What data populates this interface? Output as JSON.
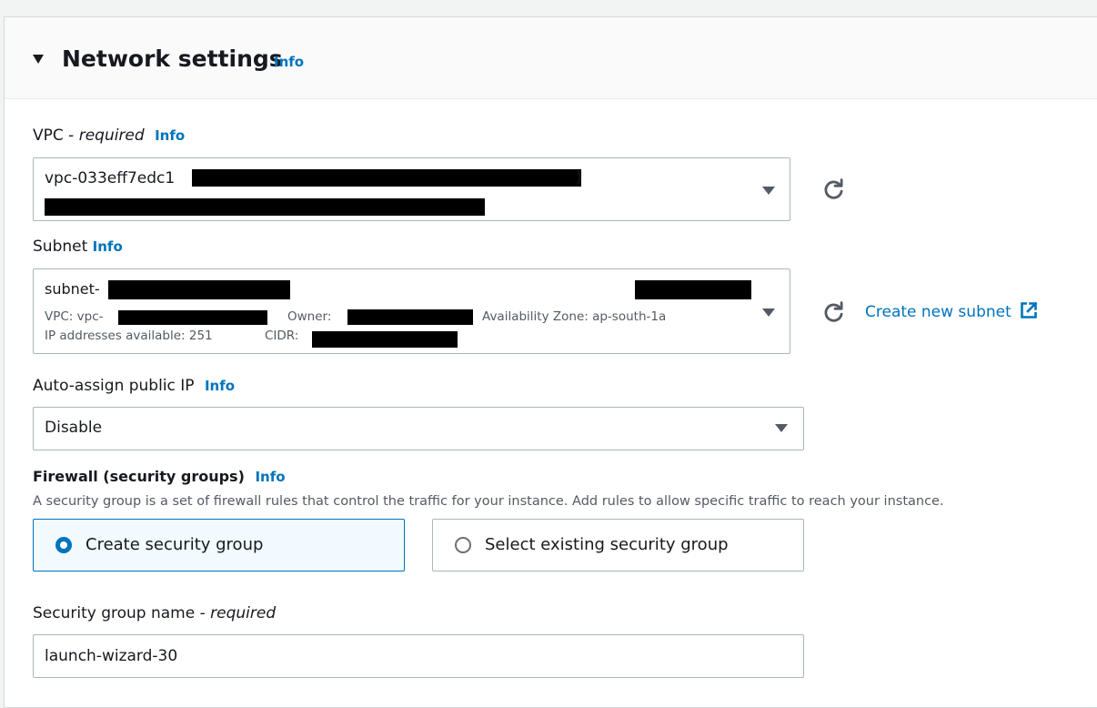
{
  "header": {
    "title": "Network settings",
    "info": "Info"
  },
  "vpc": {
    "label": "VPC - ",
    "required": "required",
    "info": "Info",
    "value": "vpc-033eff7edc1",
    "paren_close": ")"
  },
  "subnet": {
    "label": "Subnet",
    "info": "Info",
    "value": "subnet-",
    "meta_vpc": "VPC: vpc-",
    "meta_owner": "Owner: ",
    "meta_az": "Availability Zone: ap-south-1a",
    "meta_ip": "IP addresses available: 251",
    "meta_cidr": "CIDR: ",
    "create_link": "Create new subnet"
  },
  "auto_ip": {
    "label": "Auto-assign public IP",
    "info": "Info",
    "value": "Disable"
  },
  "firewall": {
    "label": "Firewall (security groups)",
    "info": "Info",
    "description": "A security group is a set of firewall rules that control the traffic for your instance. Add rules to allow specific traffic to reach your instance.",
    "option_create": "Create security group",
    "option_select": "Select existing security group",
    "selected": "create"
  },
  "sg_name": {
    "label": "Security group name - ",
    "required": "required",
    "value": "launch-wizard-30"
  },
  "colors": {
    "accent": "#0073bb",
    "border": "#aab7b8",
    "text": "#16191f"
  },
  "icons": {
    "caret": "caret-down-icon",
    "refresh": "refresh-icon",
    "external": "external-link-icon"
  }
}
